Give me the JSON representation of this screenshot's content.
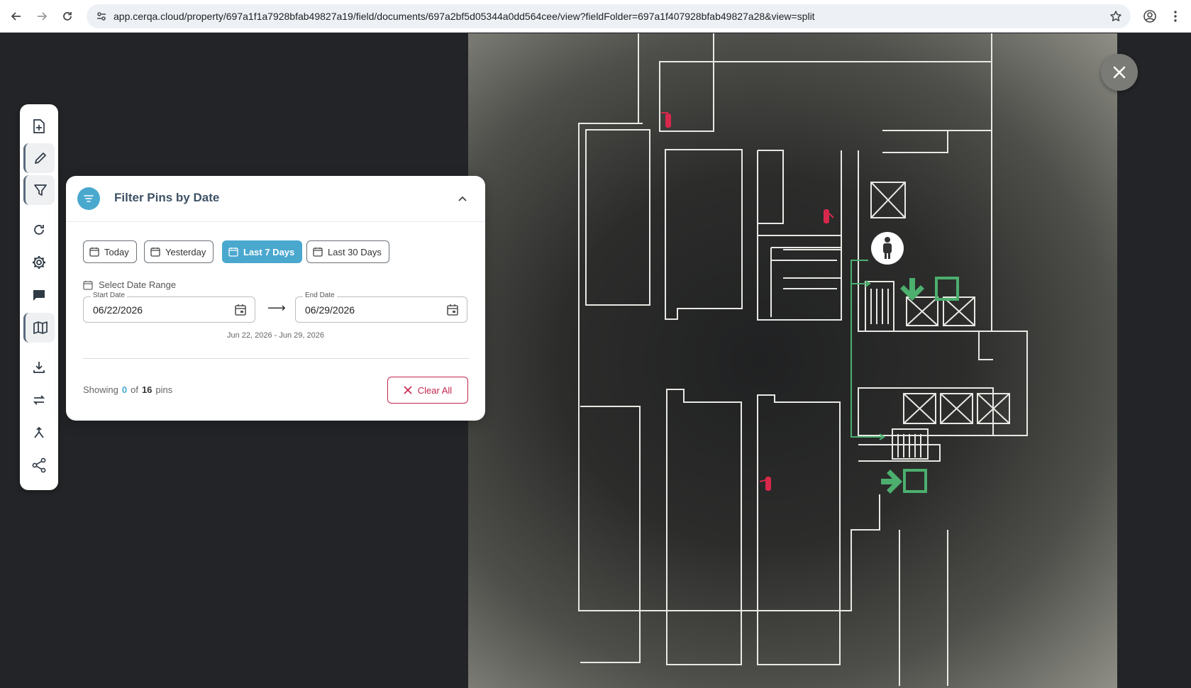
{
  "browser": {
    "url": "app.cerqa.cloud/property/697a1f1a7928bfab49827a19/field/documents/697a2bf5d05344a0dd564cee/view?fieldFolder=697a1f407928bfab49827a28&view=split"
  },
  "toolbar": {
    "tools": [
      "add-document-icon",
      "pencil-icon",
      "filter-icon",
      "refresh-icon",
      "gear-icon",
      "comment-icon",
      "map-icon",
      "download-icon",
      "swap-icon",
      "merge-icon",
      "share-icon"
    ]
  },
  "filter_panel": {
    "title": "Filter Pins by Date",
    "presets": [
      {
        "label": "Today",
        "active": false
      },
      {
        "label": "Yesterday",
        "active": false
      },
      {
        "label": "Last 7 Days",
        "active": true
      },
      {
        "label": "Last 30 Days",
        "active": false
      }
    ],
    "range_label": "Select Date Range",
    "start_label": "Start Date",
    "start_value": "06/22/2026",
    "end_label": "End Date",
    "end_value": "06/29/2026",
    "range_summary": "Jun 22, 2026 - Jun 29, 2026",
    "showing_text": "Showing",
    "shown_count": "0",
    "of_text": "of",
    "total_count": "16",
    "pins_text": "pins",
    "clear_label": "Clear All"
  },
  "colors": {
    "accent": "#4aa8cf",
    "danger": "#c2264c",
    "exit_green": "#4caf6e",
    "extinguisher_red": "#d8284c"
  }
}
